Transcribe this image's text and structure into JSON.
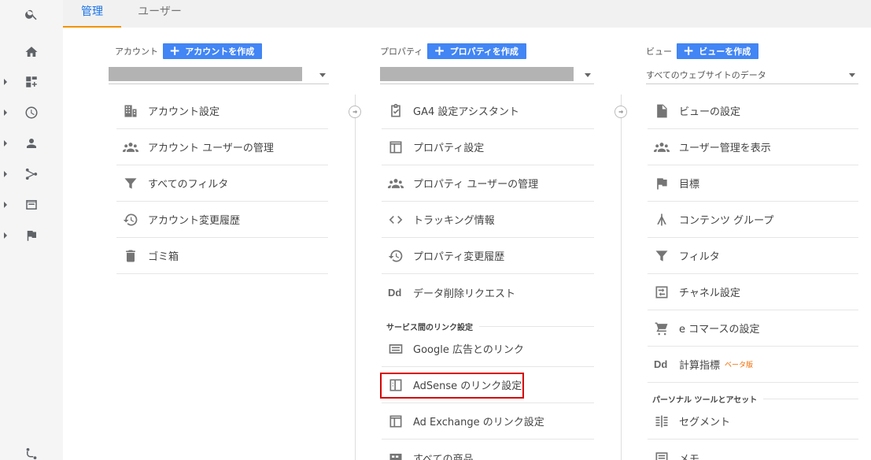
{
  "tabs": [
    {
      "label": "管理",
      "active": true
    },
    {
      "label": "ユーザー",
      "active": false
    }
  ],
  "rail": [
    "search-icon",
    "home-icon",
    "dashboard-icon",
    "clock-icon",
    "person-icon",
    "acquisition-icon",
    "behavior-icon",
    "flag-icon",
    "discover-icon"
  ],
  "account": {
    "label": "アカウント",
    "create": "アカウントを作成",
    "items": [
      {
        "icon": "building-icon",
        "label": "アカウント設定"
      },
      {
        "icon": "people-icon",
        "label": "アカウント ユーザーの管理"
      },
      {
        "icon": "filter-icon",
        "label": "すべてのフィルタ"
      },
      {
        "icon": "history-icon",
        "label": "アカウント変更履歴"
      },
      {
        "icon": "trash-icon",
        "label": "ゴミ箱"
      }
    ]
  },
  "property": {
    "label": "プロパティ",
    "create": "プロパティを作成",
    "items": [
      {
        "icon": "checklist-icon",
        "label": "GA4 設定アシスタント"
      },
      {
        "icon": "window-icon",
        "label": "プロパティ設定"
      },
      {
        "icon": "people-icon",
        "label": "プロパティ ユーザーの管理"
      },
      {
        "icon": "code-icon",
        "label": "トラッキング情報"
      },
      {
        "icon": "history-icon",
        "label": "プロパティ変更履歴"
      },
      {
        "icon": "dd-icon",
        "label": "データ削除リクエスト"
      }
    ],
    "section": "サービス間のリンク設定",
    "links": [
      {
        "icon": "ads-icon",
        "label": "Google 広告とのリンク"
      },
      {
        "icon": "adsense-icon",
        "label": "AdSense のリンク設定"
      },
      {
        "icon": "window-icon",
        "label": "Ad Exchange のリンク設定"
      },
      {
        "icon": "product-icon",
        "label": "すべての商品"
      }
    ]
  },
  "view": {
    "label": "ビュー",
    "create": "ビューを作成",
    "selected": "すべてのウェブサイトのデータ",
    "items": [
      {
        "icon": "doc-icon",
        "label": "ビューの設定"
      },
      {
        "icon": "people-icon",
        "label": "ユーザー管理を表示"
      },
      {
        "icon": "flag-icon",
        "label": "目標"
      },
      {
        "icon": "content-group-icon",
        "label": "コンテンツ グループ"
      },
      {
        "icon": "filter-icon",
        "label": "フィルタ"
      },
      {
        "icon": "channel-icon",
        "label": "チャネル設定"
      },
      {
        "icon": "cart-icon",
        "label": "e コマースの設定"
      },
      {
        "icon": "dd-icon",
        "label": "計算指標",
        "badge": "ベータ版"
      }
    ],
    "section": "パーソナル ツールとアセット",
    "tools": [
      {
        "icon": "segment-icon",
        "label": "セグメント"
      },
      {
        "icon": "note-icon",
        "label": "メモ"
      }
    ]
  },
  "dd_text": "Dd"
}
